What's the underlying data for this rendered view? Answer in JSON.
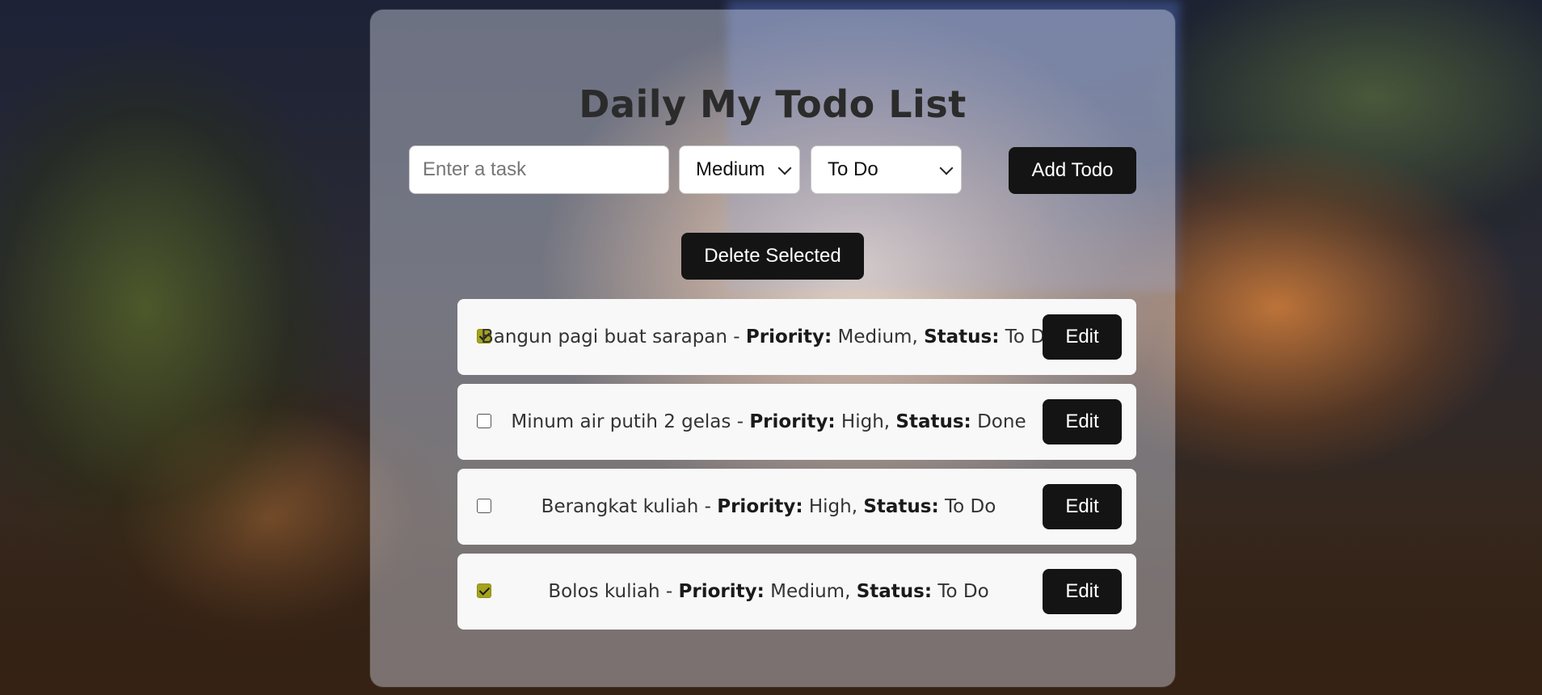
{
  "app": {
    "title": "Daily My Todo List"
  },
  "form": {
    "task_placeholder": "Enter a task",
    "task_value": "",
    "priority_selected": "Medium",
    "status_selected": "To Do",
    "add_label": "Add Todo"
  },
  "actions": {
    "delete_selected_label": "Delete Selected"
  },
  "labels": {
    "priority": "Priority:",
    "status": "Status:",
    "edit": "Edit"
  },
  "todos": [
    {
      "task": "Bangun pagi buat sarapan",
      "priority": "Medium",
      "status": "To Do",
      "checked": true
    },
    {
      "task": "Minum air putih 2 gelas",
      "priority": "High",
      "status": "Done",
      "checked": false
    },
    {
      "task": "Berangkat kuliah",
      "priority": "High",
      "status": "To Do",
      "checked": false
    },
    {
      "task": "Bolos kuliah",
      "priority": "Medium",
      "status": "To Do",
      "checked": true
    }
  ],
  "colors": {
    "button_bg": "#141414",
    "checkbox_checked": "#a5a31b",
    "card_overlay": "rgba(220,224,238,0.42)"
  }
}
